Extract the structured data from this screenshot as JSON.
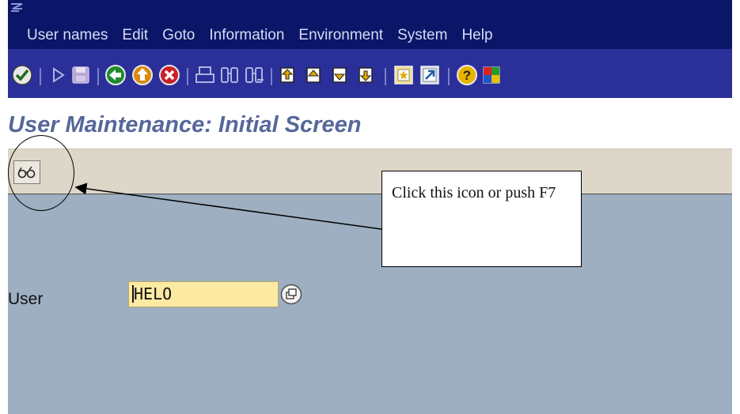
{
  "menubar": {
    "items": [
      {
        "label": "User names"
      },
      {
        "label": "Edit"
      },
      {
        "label": "Goto"
      },
      {
        "label": "Information"
      },
      {
        "label": "Environment"
      },
      {
        "label": "System"
      },
      {
        "label": "Help"
      }
    ]
  },
  "toolbar": {
    "icons": [
      "check-icon",
      "back-arrow-icon",
      "save-icon",
      "back-icon",
      "exit-icon",
      "cancel-icon",
      "print-icon",
      "find-icon",
      "find-next-icon",
      "first-page-icon",
      "previous-page-icon",
      "next-page-icon",
      "last-page-icon",
      "create-session-icon",
      "shortcut-icon",
      "help-icon",
      "layout-menu-icon"
    ]
  },
  "page": {
    "title": "User Maintenance: Initial Screen"
  },
  "form": {
    "user_label": "User",
    "user_value": "HELO"
  },
  "callout": {
    "text": "Click this icon or push F7"
  },
  "colors": {
    "menubar": "#0c1669",
    "toolbar": "#2a2f99",
    "title": "#56679a",
    "main": "#9dafc1",
    "field": "#fdeaa2"
  }
}
